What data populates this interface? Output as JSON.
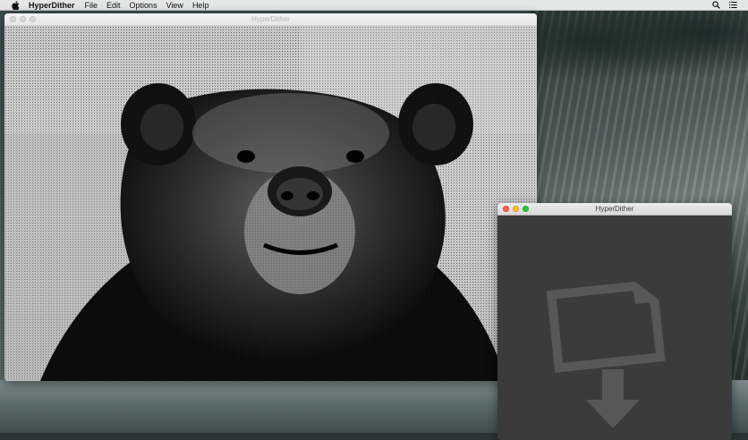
{
  "menubar": {
    "apple_icon": "apple-icon",
    "app_name": "HyperDither",
    "menus": [
      "File",
      "Edit",
      "Options",
      "View",
      "Help"
    ],
    "right_icons": [
      "search-icon",
      "list-icon"
    ]
  },
  "main_window": {
    "title": "HyperDither",
    "image_subject": "dithered-bear-image"
  },
  "drop_window": {
    "title": "HyperDither",
    "drop_icon": "drop-file-icon"
  },
  "colors": {
    "close": "#fc5f57",
    "minimize": "#fdbc2e",
    "maximize": "#28c840",
    "drop_bg": "#3b3b3b",
    "drop_icon": "#575757"
  }
}
